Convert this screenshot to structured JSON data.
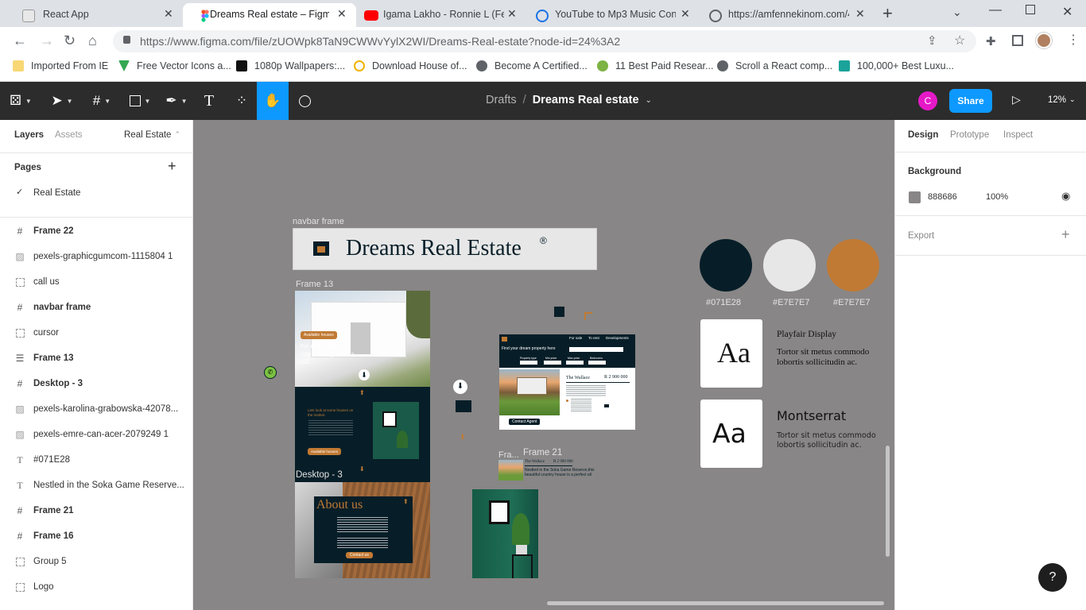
{
  "browser": {
    "tabs": [
      {
        "title": "React App",
        "icon": "react-app-favicon"
      },
      {
        "title": "Dreams Real estate – Figma",
        "icon": "figma-favicon"
      },
      {
        "title": "Igama Lakho - Ronnie L (Feat",
        "icon": "youtube-favicon"
      },
      {
        "title": "YouTube to Mp3 Music Conv",
        "icon": "converter-favicon"
      },
      {
        "title": "https://amfennekinom.com/4",
        "icon": "globe-favicon"
      }
    ],
    "url": "https://www.figma.com/file/zUOWpk8TaN9CWWvYylX2WI/Dreams-Real-estate?node-id=24%3A2",
    "bookmarks": [
      "Imported From IE",
      "Free Vector Icons a...",
      "1080p Wallpapers:...",
      "Download House of...",
      "Become A Certified...",
      "11 Best Paid Resear...",
      "Scroll a React comp...",
      "100,000+ Best Luxu..."
    ]
  },
  "figma": {
    "breadcrumb_parent": "Drafts",
    "file_name": "Dreams Real estate",
    "avatar_initial": "C",
    "share_label": "Share",
    "zoom": "12%"
  },
  "left_panel": {
    "tabs": [
      "Layers",
      "Assets"
    ],
    "page_selector": "Real Estate",
    "pages_heading": "Pages",
    "current_page": "Real Estate",
    "layers": [
      {
        "name": "Frame 22",
        "icon": "frame-icon",
        "bold": true
      },
      {
        "name": "pexels-graphicgumcom-1115804 1",
        "icon": "image-icon",
        "bold": false
      },
      {
        "name": "call us",
        "icon": "group-icon",
        "bold": false
      },
      {
        "name": "navbar frame",
        "icon": "frame-icon",
        "bold": true
      },
      {
        "name": "cursor",
        "icon": "group-icon",
        "bold": false
      },
      {
        "name": "Frame 13",
        "icon": "autolayout-icon",
        "bold": true
      },
      {
        "name": "Desktop - 3",
        "icon": "frame-icon",
        "bold": true
      },
      {
        "name": "pexels-karolina-grabowska-42078...",
        "icon": "image-icon",
        "bold": false
      },
      {
        "name": "pexels-emre-can-acer-2079249 1",
        "icon": "image-icon",
        "bold": false
      },
      {
        "name": "#071E28",
        "icon": "text-icon",
        "bold": false
      },
      {
        "name": "Nestled in the Soka Game Reserve...",
        "icon": "text-icon",
        "bold": false
      },
      {
        "name": "Frame 21",
        "icon": "frame-icon",
        "bold": true
      },
      {
        "name": "Frame 16",
        "icon": "frame-icon",
        "bold": true
      },
      {
        "name": "Group 5",
        "icon": "group-icon",
        "bold": false
      },
      {
        "name": "Logo",
        "icon": "group-icon",
        "bold": false
      }
    ]
  },
  "right_panel": {
    "tabs": [
      "Design",
      "Prototype",
      "Inspect"
    ],
    "background_heading": "Background",
    "bg_hex": "888686",
    "bg_opacity": "100%",
    "export_heading": "Export"
  },
  "canvas": {
    "navbar_frame_label": "navbar frame",
    "navbar_title": "Dreams Real Estate",
    "registered": "®",
    "frame13_label": "Frame 13",
    "desktop3_label": "Desktop - 3",
    "frame21_label": "Frame 21",
    "fra_label": "Fra...",
    "hero_badge": "Available houses",
    "hero_text": "We make dreams come true, give us a call.",
    "section2_title": "Lets look at some houses on the market.",
    "section2_button": "Available houses",
    "about_title": "About us",
    "about_button": "Contact us",
    "search_nav": [
      "For sale",
      "To rent",
      "Developments"
    ],
    "search_title": "Find your dream property here",
    "search_filters": [
      "Property type",
      "Min price",
      "Max price",
      "Bedrooms"
    ],
    "listing_title": "The Wallace",
    "listing_price": "R 2 900 000",
    "listing_button": "Contact Agent",
    "frame21_title": "The Wallace",
    "frame21_price": "R 2 900 000",
    "frame21_text": "Nestled in the Soka Game Reserve,this beautiful country house is a perfect all",
    "colors": [
      {
        "hex": "#071E28",
        "label": "#071E28"
      },
      {
        "hex": "#E7E7E7",
        "label": "#E7E7E7"
      },
      {
        "hex": "#C17A34",
        "label": "#E7E7E7"
      }
    ],
    "font_cards": [
      {
        "sample": "Aa",
        "font_name": "Playfair Display",
        "body": "Tortor sit metus commodo lobortis sollicitudin ac."
      },
      {
        "sample": "Aa",
        "font_name": "Montserrat",
        "body": "Tortor sit metus commodo lobortis sollicitudin ac."
      }
    ]
  },
  "help_label": "?"
}
